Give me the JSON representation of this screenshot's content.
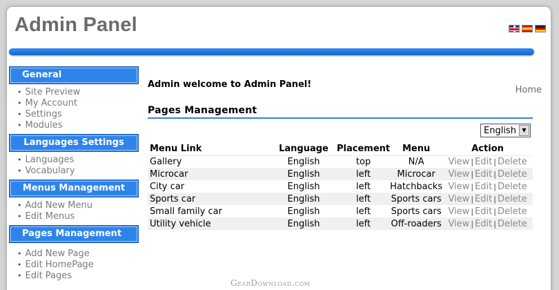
{
  "header": {
    "title": "Admin Panel",
    "flags": [
      "flag-uk-icon",
      "flag-spain-icon",
      "flag-germany-icon"
    ],
    "accent_color": "#2f84ea"
  },
  "sidebar": {
    "sections": [
      {
        "title": "General",
        "items": [
          "Site Preview",
          "My Account",
          "Settings",
          "Modules"
        ]
      },
      {
        "title": "Languages Settings",
        "items": [
          "Languages",
          "Vocabulary"
        ]
      },
      {
        "title": "Menus Management",
        "items": [
          "Add New Menu",
          "Edit Menus"
        ]
      },
      {
        "title": "Pages Management",
        "items": [
          "Add New Page",
          "Edit HomePage",
          "Edit Pages"
        ]
      }
    ]
  },
  "main": {
    "welcome": "Admin welcome to Admin Panel!",
    "home_link": "Home",
    "section_title": "Pages Management",
    "language_select": {
      "value": "English"
    },
    "table": {
      "headers": [
        "Menu Link",
        "Language",
        "Placement",
        "Menu",
        "Action"
      ],
      "rows": [
        {
          "menu_link": "Gallery",
          "language": "English",
          "placement": "top",
          "menu": "N/A"
        },
        {
          "menu_link": "Microcar",
          "language": "English",
          "placement": "left",
          "menu": "Microcar"
        },
        {
          "menu_link": "City car",
          "language": "English",
          "placement": "left",
          "menu": "Hatchbacks"
        },
        {
          "menu_link": "Sports car",
          "language": "English",
          "placement": "left",
          "menu": "Sports cars"
        },
        {
          "menu_link": "Small family car",
          "language": "English",
          "placement": "left",
          "menu": "Sports cars"
        },
        {
          "menu_link": "Utility vehicle",
          "language": "English",
          "placement": "left",
          "menu": "Off-roaders"
        }
      ],
      "actions": {
        "view": "View",
        "edit": "Edit",
        "delete": "Delete",
        "separator": "|"
      }
    }
  },
  "watermark": "GearDownload.com"
}
